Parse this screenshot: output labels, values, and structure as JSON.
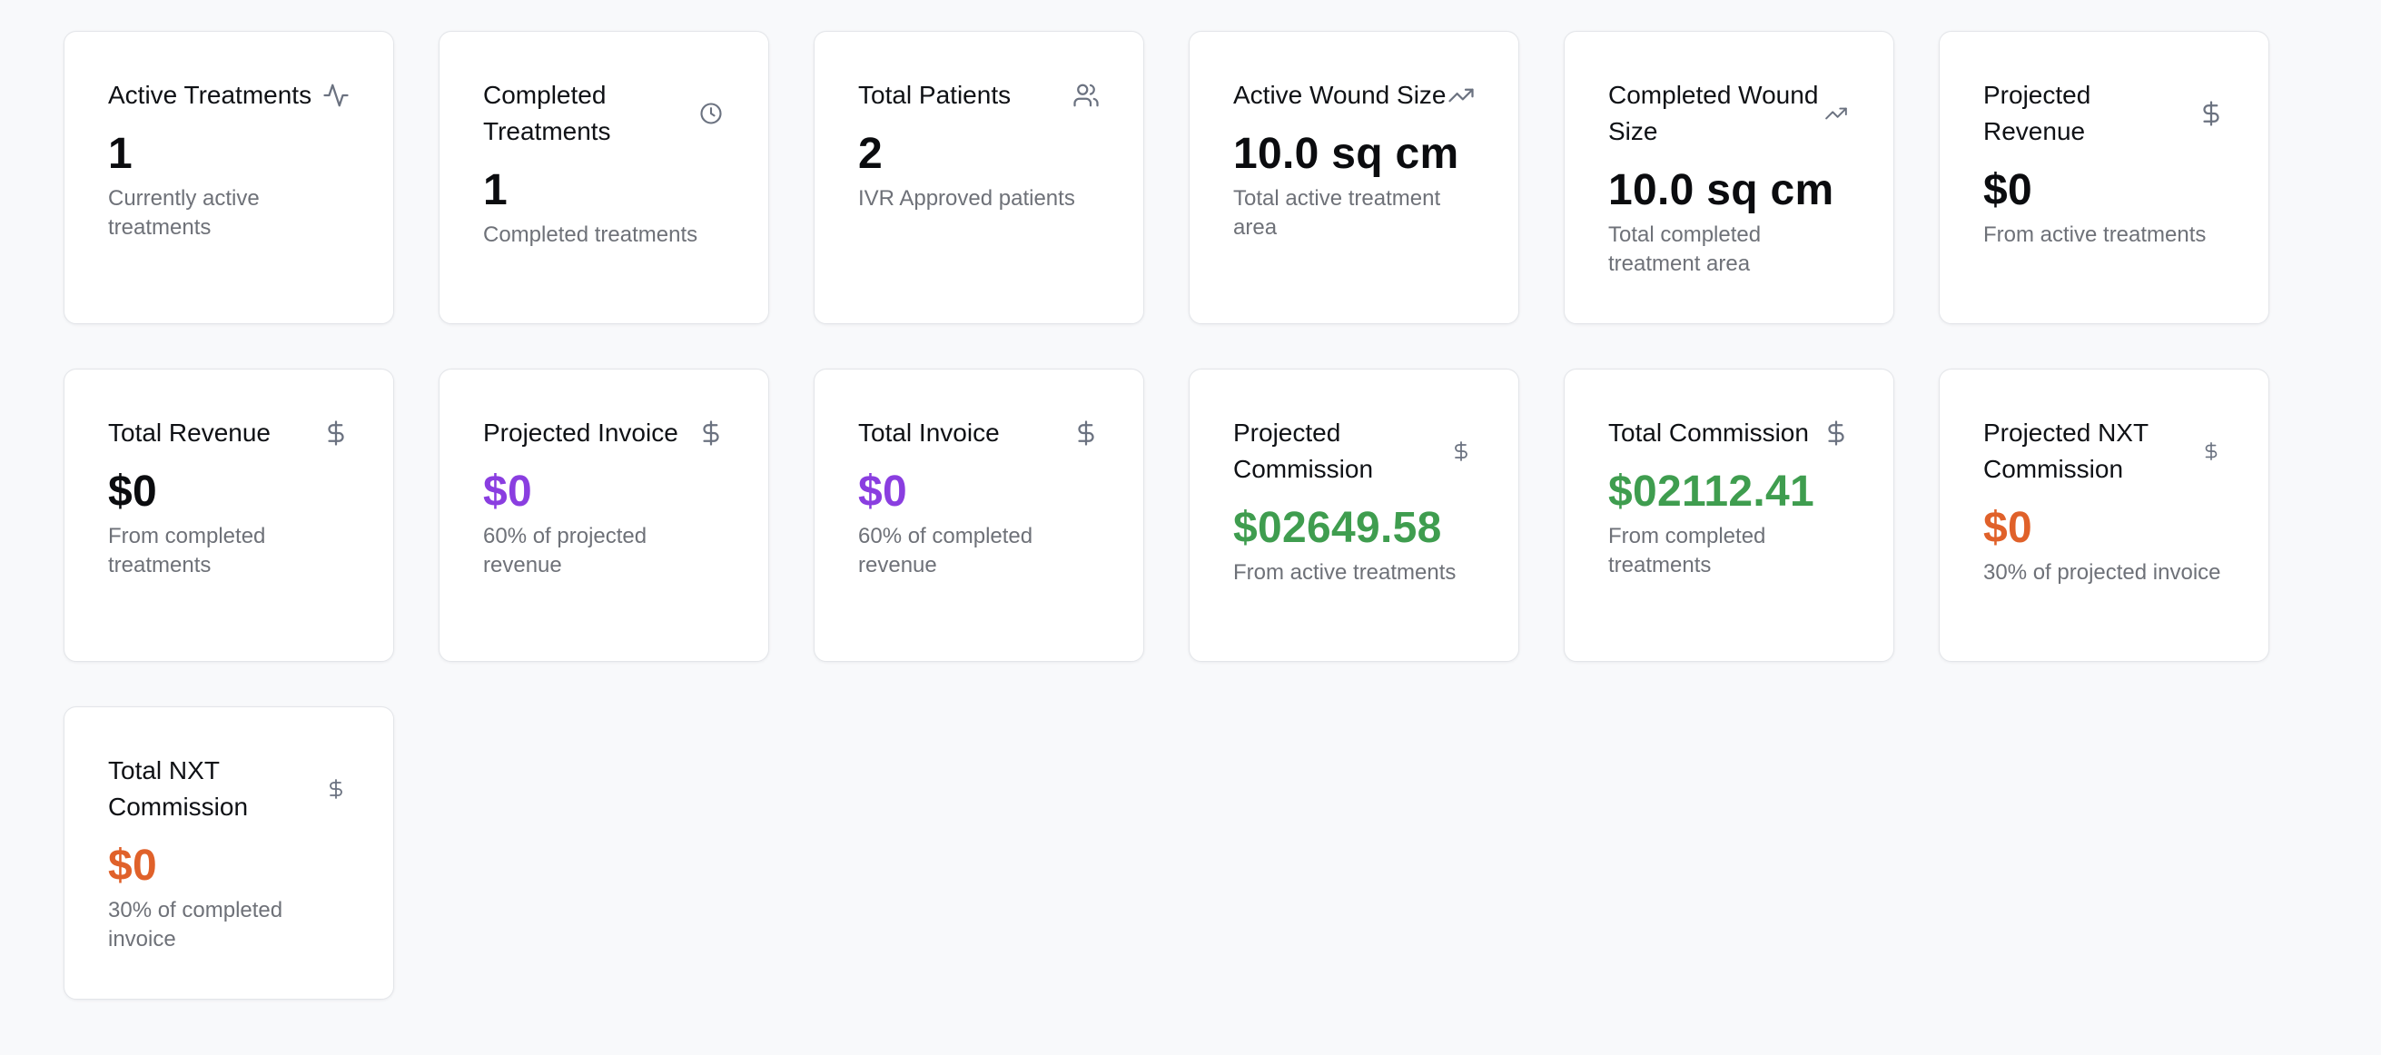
{
  "colors": {
    "purple": "#8a3ee0",
    "green": "#3f9d4f",
    "orange": "#e0612a"
  },
  "cards": [
    {
      "title": "Active Treatments",
      "value": "1",
      "subtitle": "Currently active treatments",
      "icon": "activity-icon"
    },
    {
      "title": "Completed Treatments",
      "value": "1",
      "subtitle": "Completed treatments",
      "icon": "clock-icon"
    },
    {
      "title": "Total Patients",
      "value": "2",
      "subtitle": "IVR Approved patients",
      "icon": "users-icon"
    },
    {
      "title": "Active Wound Size",
      "value": "10.0 sq cm",
      "subtitle": "Total active treatment area",
      "icon": "trending-up-icon"
    },
    {
      "title": "Completed Wound Size",
      "value": "10.0 sq cm",
      "subtitle": "Total completed treatment area",
      "icon": "trending-up-icon"
    },
    {
      "title": "Projected Revenue",
      "value": "$0",
      "subtitle": "From active treatments",
      "icon": "dollar-icon"
    },
    {
      "title": "Total Revenue",
      "value": "$0",
      "subtitle": "From completed treatments",
      "icon": "dollar-icon"
    },
    {
      "title": "Projected Invoice",
      "value": "$0",
      "subtitle": "60% of projected revenue",
      "icon": "dollar-icon",
      "value_color": "purple"
    },
    {
      "title": "Total Invoice",
      "value": "$0",
      "subtitle": "60% of completed revenue",
      "icon": "dollar-icon",
      "value_color": "purple"
    },
    {
      "title": "Projected Commission",
      "value": "$02649.58",
      "subtitle": "From active treatments",
      "icon": "dollar-icon",
      "value_color": "green"
    },
    {
      "title": "Total Commission",
      "value": "$02112.41",
      "subtitle": "From completed treatments",
      "icon": "dollar-icon",
      "value_color": "green"
    },
    {
      "title": "Projected NXT Commission",
      "value": "$0",
      "subtitle": "30% of projected invoice",
      "icon": "dollar-icon",
      "value_color": "orange"
    },
    {
      "title": "Total NXT Commission",
      "value": "$0",
      "subtitle": "30% of completed invoice",
      "icon": "dollar-icon",
      "value_color": "orange"
    }
  ]
}
